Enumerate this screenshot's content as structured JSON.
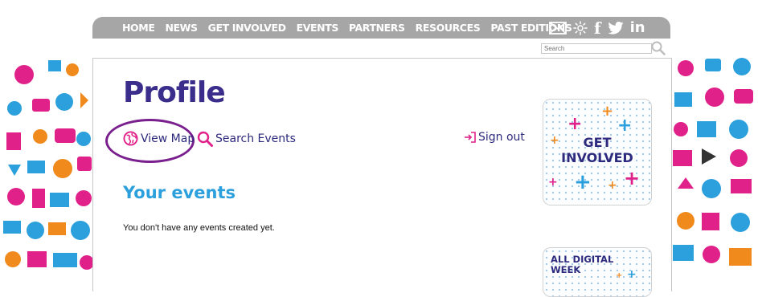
{
  "nav": {
    "items": [
      "HOME",
      "NEWS",
      "GET INVOLVED",
      "EVENTS",
      "PARTNERS",
      "RESOURCES",
      "PAST EDITIONS"
    ],
    "icons": [
      "envelope-icon",
      "rss-sun-icon",
      "facebook-icon",
      "twitter-icon",
      "linkedin-icon"
    ],
    "facebook_glyph": "f",
    "linkedin_glyph": "in"
  },
  "search": {
    "placeholder": "Search"
  },
  "main": {
    "title": "Profile",
    "links": {
      "view_map": "View Map",
      "search_events": "Search Events",
      "sign_out": "Sign out"
    },
    "section_title": "Your events",
    "empty_message": "You don't have any events created yet."
  },
  "promos": {
    "get_involved": {
      "line1": "GET",
      "line2": "INVOLVED"
    },
    "digital_week": {
      "line1": "ALL DIGITAL",
      "line2": "WEEK"
    }
  },
  "colors": {
    "nav_bg": "#a6a6a6",
    "title": "#3a2d8b",
    "section_title": "#2ba0dc",
    "highlight_circle": "#7a1f8e",
    "accent_pink": "#e0218a",
    "accent_orange": "#f08a1c",
    "accent_blue": "#2ba0dc"
  }
}
